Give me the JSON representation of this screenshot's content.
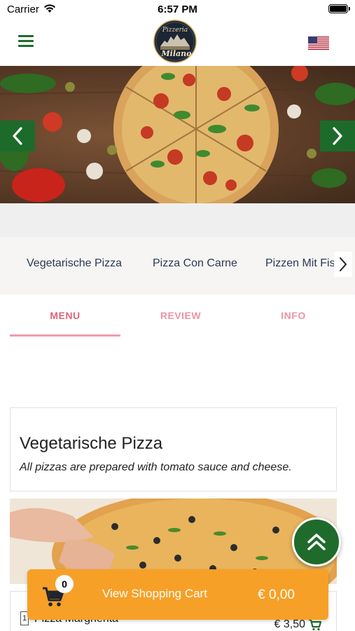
{
  "status_bar": {
    "carrier": "Carrier",
    "time": "6:57 PM"
  },
  "header": {
    "logo_text_top": "Pizzeria",
    "logo_text_bottom": "Milano",
    "brand_color": "#1e6b2b",
    "language_flag": "us-flag-icon"
  },
  "categories": [
    "Vegetarische Pizza",
    "Pizza Con Carne",
    "Pizzen Mit Fisch"
  ],
  "tabs": [
    {
      "label": "MENU",
      "active": true
    },
    {
      "label": "REVIEW",
      "active": false
    },
    {
      "label": "INFO",
      "active": false
    }
  ],
  "section": {
    "title": "Vegetarische Pizza",
    "description": "All pizzas are prepared with tomato sauce and cheese."
  },
  "first_item": {
    "quantity": "1",
    "name": "Pizza Margherita",
    "price": "€ 3,50"
  },
  "cart": {
    "count": "0",
    "label": "View Shopping Cart",
    "total": "€ 0,00",
    "color": "#f7a027"
  },
  "icons": {
    "menu": "hamburger-icon",
    "prev": "chevron-left-icon",
    "next": "chevron-right-icon",
    "scroll_top": "double-chevron-up-icon",
    "cart": "shopping-cart-icon"
  },
  "colors": {
    "tab_active": "#e0637a",
    "tab_inactive": "#ec93a4",
    "category_text": "#2a3a55"
  }
}
